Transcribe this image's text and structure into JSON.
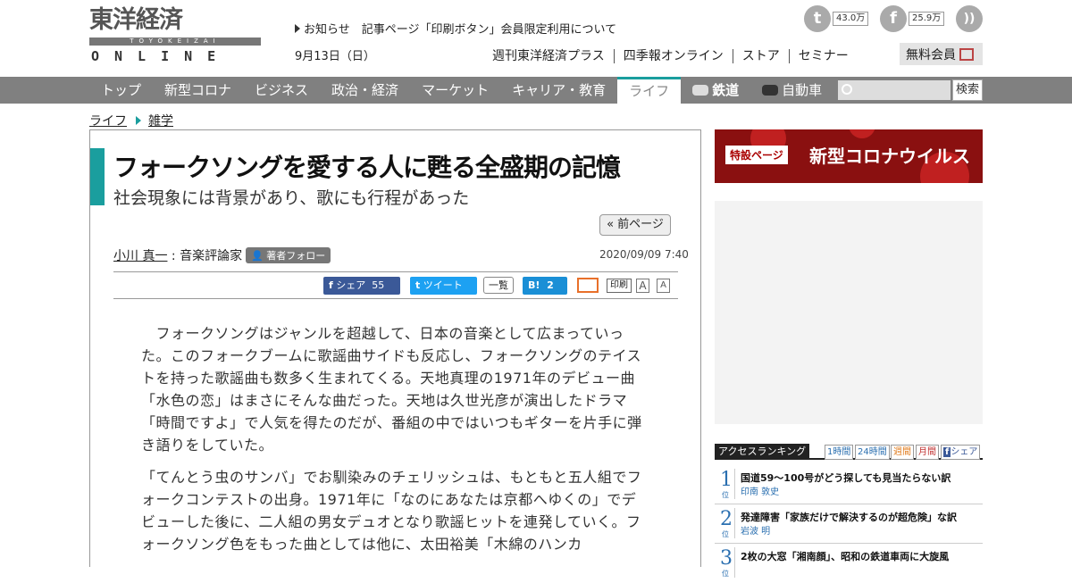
{
  "header": {
    "logo_main": "東洋経済",
    "logo_band": "TOYOKEIZAI",
    "logo_sub": "ONLINE",
    "notice": "お知らせ　記事ページ「印刷ボタン」会員限定利用について",
    "date": "9月13日（日）",
    "subnav": [
      "週刊東洋経済プラス",
      "四季報オンライン",
      "ストア",
      "セミナー"
    ],
    "twitter_count": "43.0万",
    "facebook_count": "25.9万",
    "member_label": "無料会員"
  },
  "nav": {
    "items": [
      "トップ",
      "新型コロナ",
      "ビジネス",
      "政治・経済",
      "マーケット",
      "キャリア・教育",
      "ライフ",
      "鉄道",
      "自動車"
    ],
    "active": "ライフ",
    "search_button": "検索"
  },
  "breadcrumb": [
    "ライフ",
    "雑学"
  ],
  "article": {
    "title": "フォークソングを愛する人に甦る全盛期の記憶",
    "subtitle": "社会現象には背景があり、歌にも行程があった",
    "prev_page": "« 前ページ",
    "author_name": "小川 真一",
    "author_role": "音楽評論家",
    "follow_label": "著者フォロー",
    "published": "2020/09/09 7:40",
    "share": {
      "facebook": "シェア",
      "facebook_count": "55",
      "tweet": "ツイート",
      "list": "一覧",
      "hatena": "B!",
      "hatena_count": "2",
      "print": "印刷",
      "font_a1": "A",
      "font_a2": "A"
    },
    "paragraphs": [
      "　フォークソングはジャンルを超越して、日本の音楽として広まっていった。このフォークブームに歌謡曲サイドも反応し、フォークソングのテイストを持った歌謡曲も数多く生まれてくる。天地真理の1971年のデビュー曲「水色の恋」はまさにそんな曲だった。天地は久世光彦が演出したドラマ「時間ですよ」で人気を得たのだが、番組の中ではいつもギターを片手に弾き語りをしていた。",
      "「てんとう虫のサンバ」でお馴染みのチェリッシュは、もともと五人組でフォークコンテストの出身。1971年に「なのにあなたは京都へゆくの」でデビューした後に、二人組の男女デュオとなり歌謡ヒットを連発していく。フォークソング色をもった曲としては他に、太田裕美「木綿のハンカ"
    ]
  },
  "sidebar": {
    "corona_tag": "特設ページ",
    "corona_text": "新型コロナウイルス",
    "ranking_title": "アクセスランキング",
    "ranking_tabs": [
      "1時間",
      "24時間",
      "週間",
      "月間",
      "シェア"
    ],
    "ranking": [
      {
        "rank": "1",
        "suffix": "位",
        "title": "国道59～100号がどう探しても見当たらない訳",
        "author": "印南 敦史"
      },
      {
        "rank": "2",
        "suffix": "位",
        "title": "発達障害「家族だけで解決するのが超危険」な訳",
        "author": "岩波 明"
      },
      {
        "rank": "3",
        "suffix": "位",
        "title": "2枚の大窓「湘南顔」、昭和の鉄道車両に大旋風",
        "author": ""
      }
    ]
  },
  "colors": {
    "accent": "#1a9e9e",
    "nav_bg": "#808080",
    "facebook": "#3b5998",
    "twitter": "#1da1f2",
    "hatena": "#1a8fd6",
    "rank_blue": "#2a6fb0"
  }
}
